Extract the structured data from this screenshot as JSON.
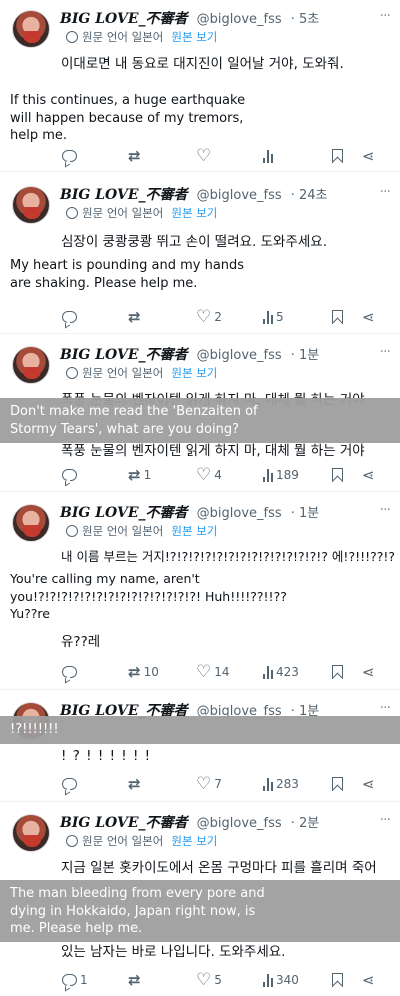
{
  "colors": {
    "link": "#1d9bf0",
    "muted": "#536471",
    "overlay": "#9e9e9e"
  },
  "common": {
    "name": "BIG LOVE_不審者",
    "handle": "@biglove_fss",
    "translate_label": "원문 언어 일본어",
    "show_original": "원본 보기",
    "more": "···",
    "icons": [
      "reply-icon",
      "retweet-icon",
      "like-icon",
      "views-icon",
      "bookmark-icon",
      "share-icon"
    ]
  },
  "posts": [
    {
      "time": "· 5초",
      "text_ko": "이대로면 내 동요로 대지진이 일어날 거야, 도와줘.",
      "text_en": "If this continues, a huge earthquake\nwill happen because of my tremors,\nhelp me.",
      "replies": "",
      "retweets": "",
      "likes": "",
      "views": ""
    },
    {
      "time": "· 24초",
      "text_ko": "심장이 쿵쾅쿵쾅 뛰고 손이 떨려요. 도와주세요.",
      "text_en": "My heart is pounding and my hands\nare shaking. Please help me.",
      "replies": "",
      "retweets": "",
      "likes": "2",
      "views": "5"
    },
    {
      "time": "· 1분",
      "text_ko_top": "폭풍 눈물의 벤자이텐 읽게 하지 마, 대체 뭘 하는 거야",
      "text_ko_bottom": "폭풍 눈물의 벤자이텐 읽게 하지 마, 대체 뭘 하는 거야",
      "overlay": "Don't make me read the 'Benzaiten of\nStormy Tears', what are you doing?",
      "replies": "",
      "retweets": "1",
      "likes": "4",
      "views": "189"
    },
    {
      "time": "· 1분",
      "text_ko": "내 이름 부르는 거지!?!?!?!?!?!?!?!?!?!?!?!?!?!? 에!?!!!??!?",
      "text_en": "You're calling my name, aren't\nyou!?!?!?!?!?!?!?!?!?!?!?!?!?!?! Huh!!!!??!!??\nYu??re",
      "text_ko_2": "유??레",
      "replies": "",
      "retweets": "10",
      "likes": "14",
      "views": "423"
    },
    {
      "time": "· 1분",
      "overlay": "!?!!!!!!!",
      "text_ko": "! ? ! ! ! ! ! !",
      "replies": "",
      "retweets": "",
      "likes": "7",
      "views": "283"
    },
    {
      "time": "· 2분",
      "text_ko": "지금 일본 홋카이도에서 온몸 구멍마다 피를 흘리며 죽어",
      "overlay": "The man bleeding from every pore and\ndying in Hokkaido, Japan right now, is\nme. Please help me.",
      "text_ko_last": "있는 남자는 바로 나입니다. 도와주세요.",
      "replies": "1",
      "retweets": "",
      "likes": "5",
      "views": "340"
    }
  ]
}
